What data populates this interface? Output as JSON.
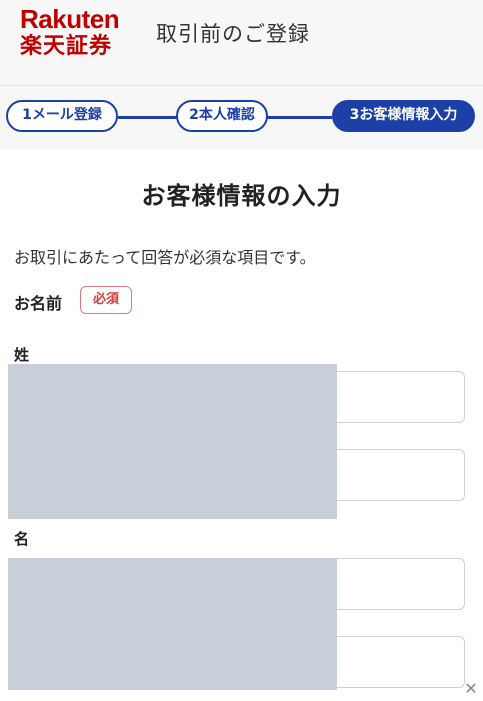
{
  "header": {
    "logo_en": "Rakuten",
    "logo_jp": "楽天証券",
    "title": "取引前のご登録"
  },
  "steps": [
    {
      "label": "1メール登録",
      "state": "done"
    },
    {
      "label": "2本人確認",
      "state": "done"
    },
    {
      "label": "3お客様情報入力",
      "state": "active"
    }
  ],
  "main": {
    "title": "お客様情報の入力",
    "intro": "お取引にあたって回答が必須な項目です。",
    "name_field": {
      "label": "お名前",
      "required_badge": "必須",
      "sei_label": "姓",
      "mei_label": "名"
    }
  },
  "colors": {
    "brand_red": "#bf0000",
    "step_blue": "#1c3fa8",
    "required_red": "#d23b3b"
  },
  "icons": {
    "close": "close-icon"
  }
}
